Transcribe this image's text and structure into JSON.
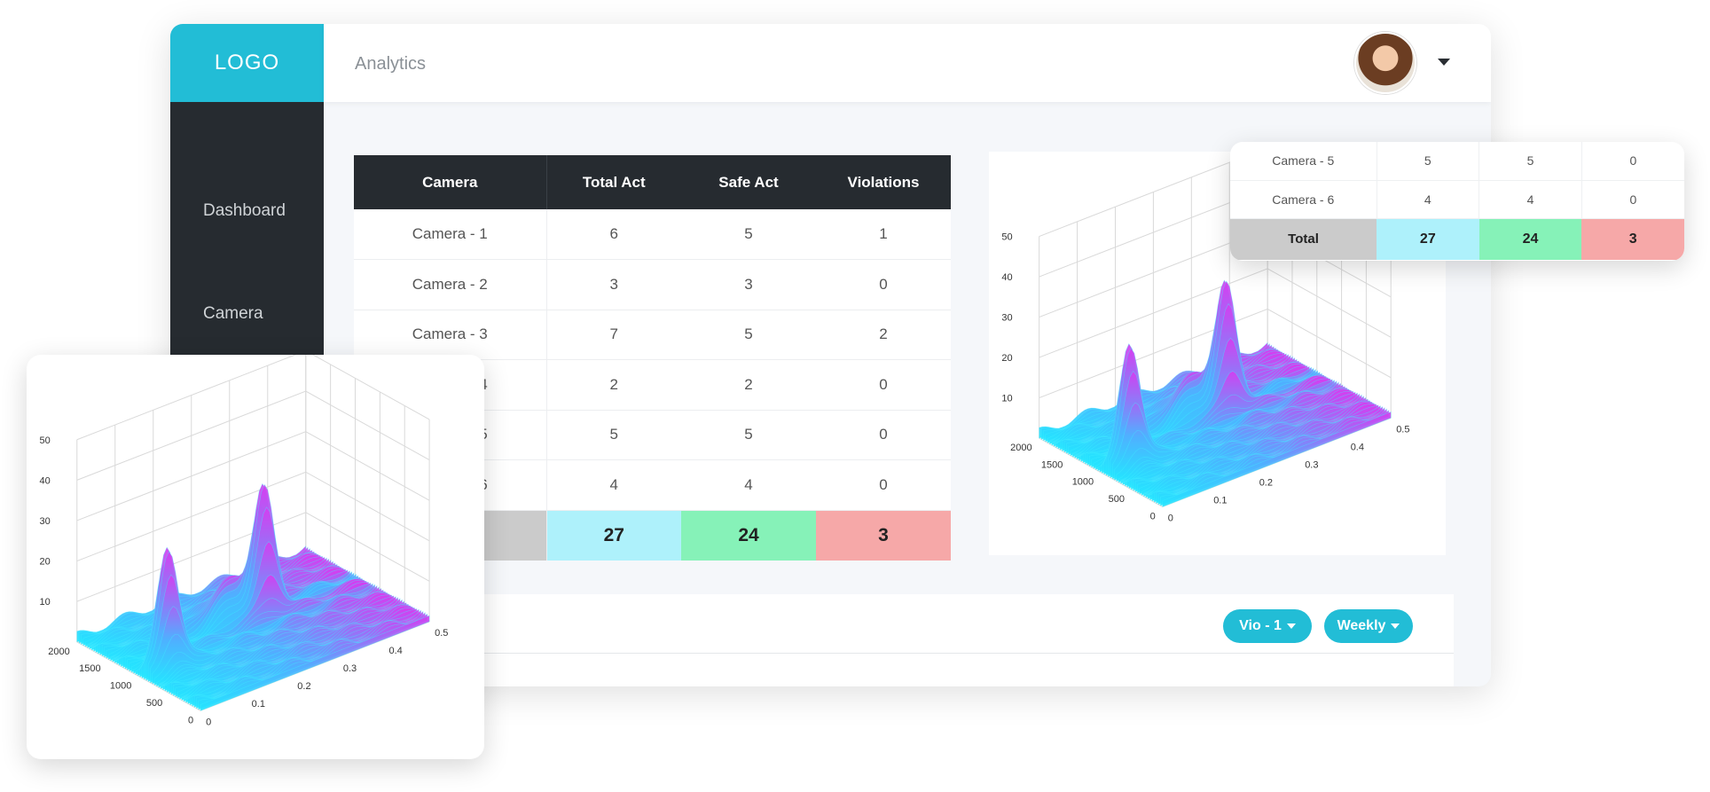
{
  "header": {
    "logo": "LOGO",
    "page_title": "Analytics"
  },
  "sidebar": {
    "items": [
      {
        "label": "Dashboard"
      },
      {
        "label": "Camera"
      }
    ]
  },
  "table": {
    "headers": [
      "Camera",
      "Total Act",
      "Safe Act",
      "Violations"
    ],
    "rows": [
      {
        "camera": "Camera - 1",
        "total": "6",
        "safe": "5",
        "violations": "1"
      },
      {
        "camera": "Camera - 2",
        "total": "3",
        "safe": "3",
        "violations": "0"
      },
      {
        "camera": "Camera - 3",
        "total": "7",
        "safe": "5",
        "violations": "2"
      },
      {
        "camera": "Camera - 4",
        "total": "2",
        "safe": "2",
        "violations": "0"
      },
      {
        "camera": "Camera - 5",
        "total": "5",
        "safe": "5",
        "violations": "0"
      },
      {
        "camera": "Camera - 6",
        "total": "4",
        "safe": "4",
        "violations": "0"
      }
    ],
    "totals": {
      "label": "Total",
      "total": "27",
      "safe": "24",
      "violations": "3"
    }
  },
  "mini_table": {
    "rows": [
      {
        "camera": "Camera - 5",
        "total": "5",
        "safe": "5",
        "violations": "0"
      },
      {
        "camera": "Camera - 6",
        "total": "4",
        "safe": "4",
        "violations": "0"
      }
    ],
    "totals": {
      "label": "Total",
      "total": "27",
      "safe": "24",
      "violations": "3"
    }
  },
  "filters": {
    "violation": "Vio - 1",
    "period": "Weekly"
  },
  "colors": {
    "accent": "#22bdd6",
    "sidebar": "#262b30",
    "total_cyan": "#aef1fb",
    "total_green": "#86f2b8",
    "total_red": "#f6a8a8",
    "total_gray": "#cbcbcb"
  },
  "chart_data": [
    {
      "type": "surface",
      "z_ticks": [
        "10",
        "20",
        "30",
        "40",
        "50"
      ],
      "y_ticks": [
        "2000",
        "1500",
        "1000",
        "500",
        "0"
      ],
      "x_ticks": [
        "0",
        "0.1",
        "0.2",
        "0.3",
        "0.4",
        "0.5"
      ],
      "zlim": [
        0,
        50
      ],
      "ylim": [
        0,
        2000
      ],
      "xlim": [
        0,
        0.5
      ],
      "peaks": [
        {
          "x": 0.05,
          "y": 900,
          "z": 30
        },
        {
          "x": 0.3,
          "y": 1200,
          "z": 30
        }
      ]
    },
    {
      "type": "surface",
      "z_ticks": [
        "10",
        "20",
        "30",
        "40",
        "50"
      ],
      "y_ticks": [
        "2000",
        "1500",
        "1000",
        "500",
        "0"
      ],
      "x_ticks": [
        "0",
        "0.1",
        "0.2",
        "0.3",
        "0.4",
        "0.5"
      ],
      "zlim": [
        0,
        50
      ],
      "ylim": [
        0,
        2000
      ],
      "xlim": [
        0,
        0.5
      ],
      "peaks": [
        {
          "x": 0.05,
          "y": 900,
          "z": 30
        },
        {
          "x": 0.3,
          "y": 1200,
          "z": 30
        }
      ]
    }
  ]
}
